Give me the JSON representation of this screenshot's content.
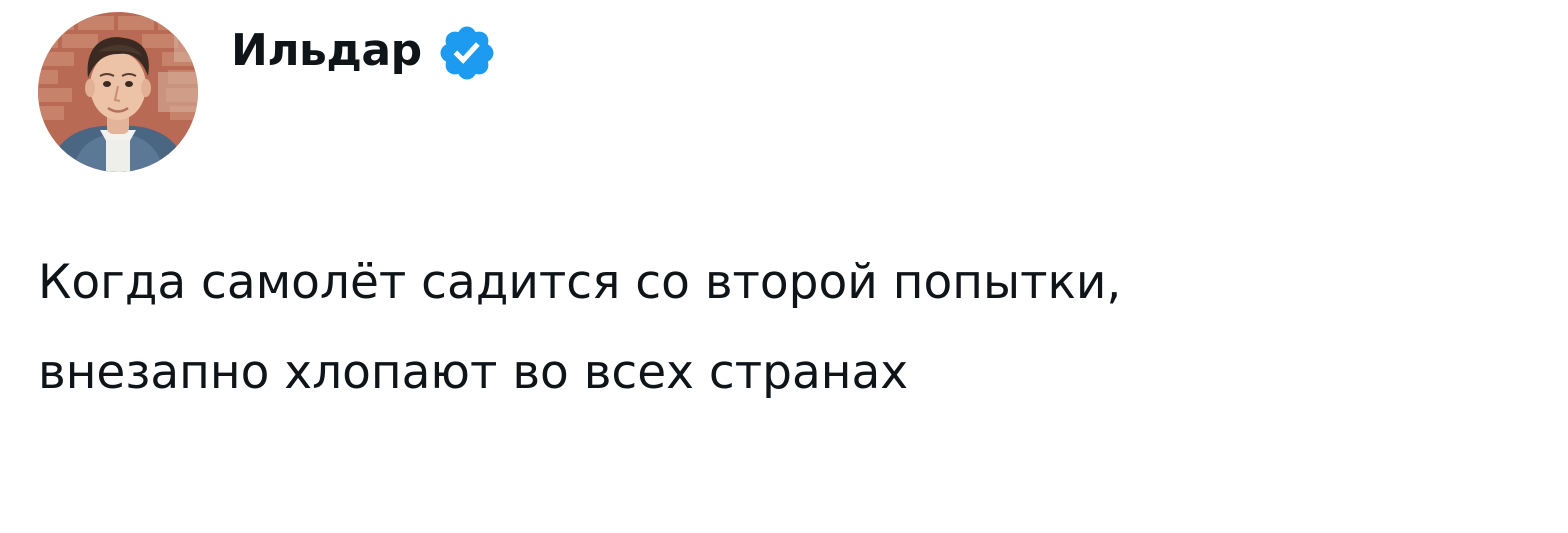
{
  "author": {
    "display_name": "Ильдар",
    "verified": true,
    "verified_icon": "verified-badge-icon",
    "badge_color": "#1d9bf0"
  },
  "tweet": {
    "text": "Когда самолёт садится со второй попытки,\nвнезапно хлопают во всех странах"
  },
  "colors": {
    "text": "#0f1419",
    "background": "#ffffff"
  }
}
